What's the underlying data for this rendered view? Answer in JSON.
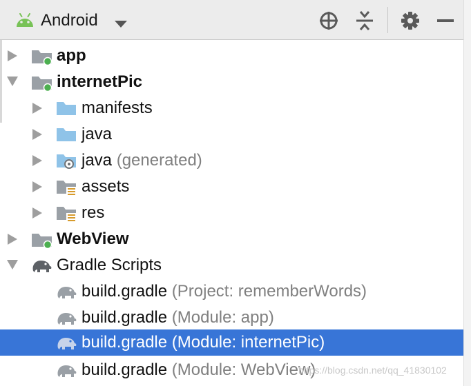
{
  "toolbar": {
    "view_label": "Android",
    "icons": [
      "android-icon",
      "chevron-down-icon",
      "locate-icon",
      "collapse-all-icon",
      "gear-icon",
      "minimize-icon"
    ]
  },
  "tree": {
    "items": [
      {
        "name": "app",
        "hint": "",
        "bold": true,
        "expanded": false,
        "icon": "module-folder-icon"
      },
      {
        "name": "internetPic",
        "hint": "",
        "bold": true,
        "expanded": true,
        "icon": "module-folder-icon"
      },
      {
        "name": "manifests",
        "hint": "",
        "bold": false,
        "expanded": false,
        "icon": "folder-icon"
      },
      {
        "name": "java",
        "hint": "",
        "bold": false,
        "expanded": false,
        "icon": "folder-icon"
      },
      {
        "name": "java",
        "hint": "(generated)",
        "bold": false,
        "expanded": false,
        "icon": "generated-folder-icon"
      },
      {
        "name": "assets",
        "hint": "",
        "bold": false,
        "expanded": false,
        "icon": "resource-folder-icon"
      },
      {
        "name": "res",
        "hint": "",
        "bold": false,
        "expanded": false,
        "icon": "resource-folder-icon"
      },
      {
        "name": "WebView",
        "hint": "",
        "bold": true,
        "expanded": false,
        "icon": "module-folder-icon"
      },
      {
        "name": "Gradle Scripts",
        "hint": "",
        "bold": false,
        "expanded": true,
        "icon": "gradle-elephant-icon"
      },
      {
        "name": "build.gradle",
        "hint": "(Project: rememberWords)",
        "bold": false,
        "icon": "gradle-elephant-icon"
      },
      {
        "name": "build.gradle",
        "hint": "(Module: app)",
        "bold": false,
        "icon": "gradle-elephant-icon"
      },
      {
        "name": "build.gradle",
        "hint": "(Module: internetPic)",
        "bold": false,
        "selected": true,
        "icon": "gradle-elephant-icon"
      },
      {
        "name": "build.gradle",
        "hint": "(Module: WebView)",
        "bold": false,
        "icon": "gradle-elephant-icon"
      }
    ]
  },
  "watermark": "https://blog.csdn.net/qq_41830102",
  "colors": {
    "selection": "#3875d7",
    "folder_blue": "#8fc3e8",
    "module_gray": "#9aa0a6",
    "module_dot": "#4caf50",
    "android_green": "#78c257",
    "hint_gray": "#808080"
  }
}
